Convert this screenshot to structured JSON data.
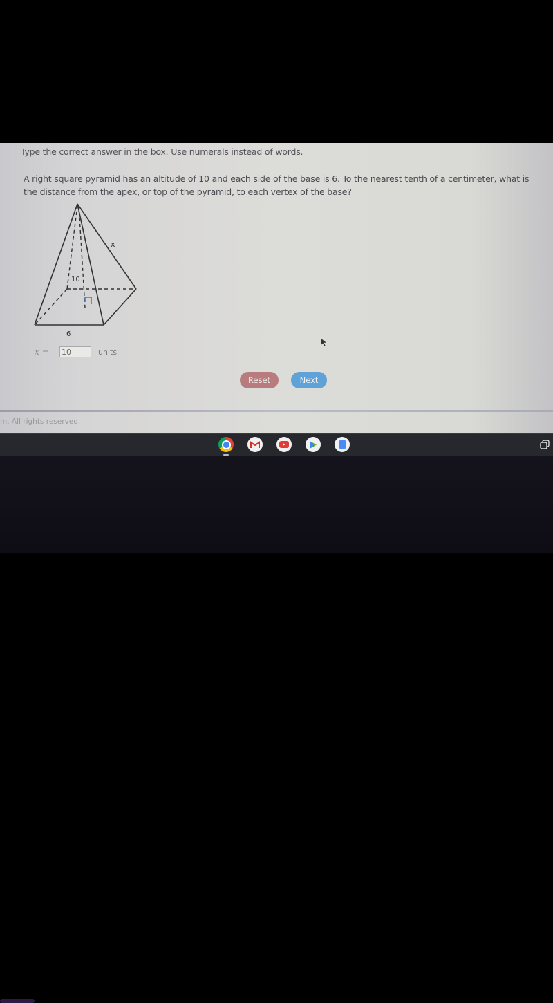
{
  "instruction": "Type the correct answer in the box. Use numerals instead of words.",
  "question": "A right square pyramid has an altitude of 10 and each side of the base is 6. To the nearest tenth of a centimeter, what is the distance from the apex, or top of the pyramid, to each vertex of the base?",
  "figure": {
    "label_edge": "x",
    "label_altitude": "10",
    "label_base": "6"
  },
  "answer": {
    "label": "x =",
    "value": "10",
    "units": "units"
  },
  "buttons": {
    "reset": "Reset",
    "next": "Next"
  },
  "colors": {
    "reset": "#b87c7e",
    "next": "#5ea2d8",
    "right_angle_marker": "#4a78b8"
  },
  "footer": "m. All rights reserved.",
  "shelf": {
    "apps": [
      "chrome-icon",
      "gmail-icon",
      "youtube-icon",
      "play-store-icon",
      "docs-icon"
    ]
  }
}
